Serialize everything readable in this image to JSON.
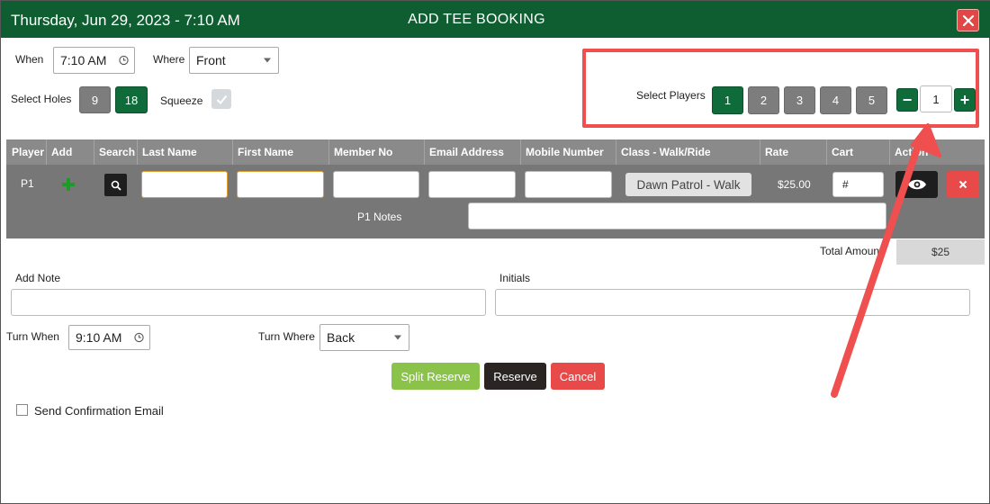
{
  "header": {
    "datetime": "Thursday, Jun 29, 2023 - 7:10 AM",
    "title": "ADD TEE BOOKING",
    "close_icon": "close-icon"
  },
  "when": {
    "label": "When",
    "value": "7:10 AM"
  },
  "where": {
    "label": "Where",
    "value": "Front"
  },
  "holes": {
    "label": "Select Holes",
    "options": [
      "9",
      "18"
    ],
    "selected": "18"
  },
  "squeeze": {
    "label": "Squeeze",
    "checked": true
  },
  "players": {
    "label": "Select Players",
    "options": [
      "1",
      "2",
      "3",
      "4",
      "5"
    ],
    "selected": "1",
    "minus": "−",
    "plus": "+",
    "count": "1"
  },
  "table": {
    "columns": [
      "Player",
      "Add",
      "Search",
      "Last Name",
      "First Name",
      "Member No",
      "Email Address",
      "Mobile Number",
      "Class - Walk/Ride",
      "Rate",
      "Cart",
      "Action"
    ],
    "row": {
      "player": "P1",
      "class": "Dawn Patrol - Walk",
      "rate": "$25.00",
      "cart": "#",
      "notes_label": "P1 Notes"
    }
  },
  "total": {
    "label": "Total Amount",
    "value": "$25"
  },
  "add_note": {
    "label": "Add Note"
  },
  "initials": {
    "label": "Initials"
  },
  "turn_when": {
    "label": "Turn When",
    "value": "9:10 AM"
  },
  "turn_where": {
    "label": "Turn Where",
    "value": "Back"
  },
  "actions": {
    "split": "Split Reserve",
    "reserve": "Reserve",
    "cancel": "Cancel"
  },
  "confirmation": {
    "label": "Send Confirmation Email",
    "checked": false
  },
  "colors": {
    "header": "#0f5e32",
    "primary": "#0f6b3a",
    "annotation": "#ef4f4f",
    "split": "#8bc34a",
    "cancel": "#e84a4a"
  }
}
